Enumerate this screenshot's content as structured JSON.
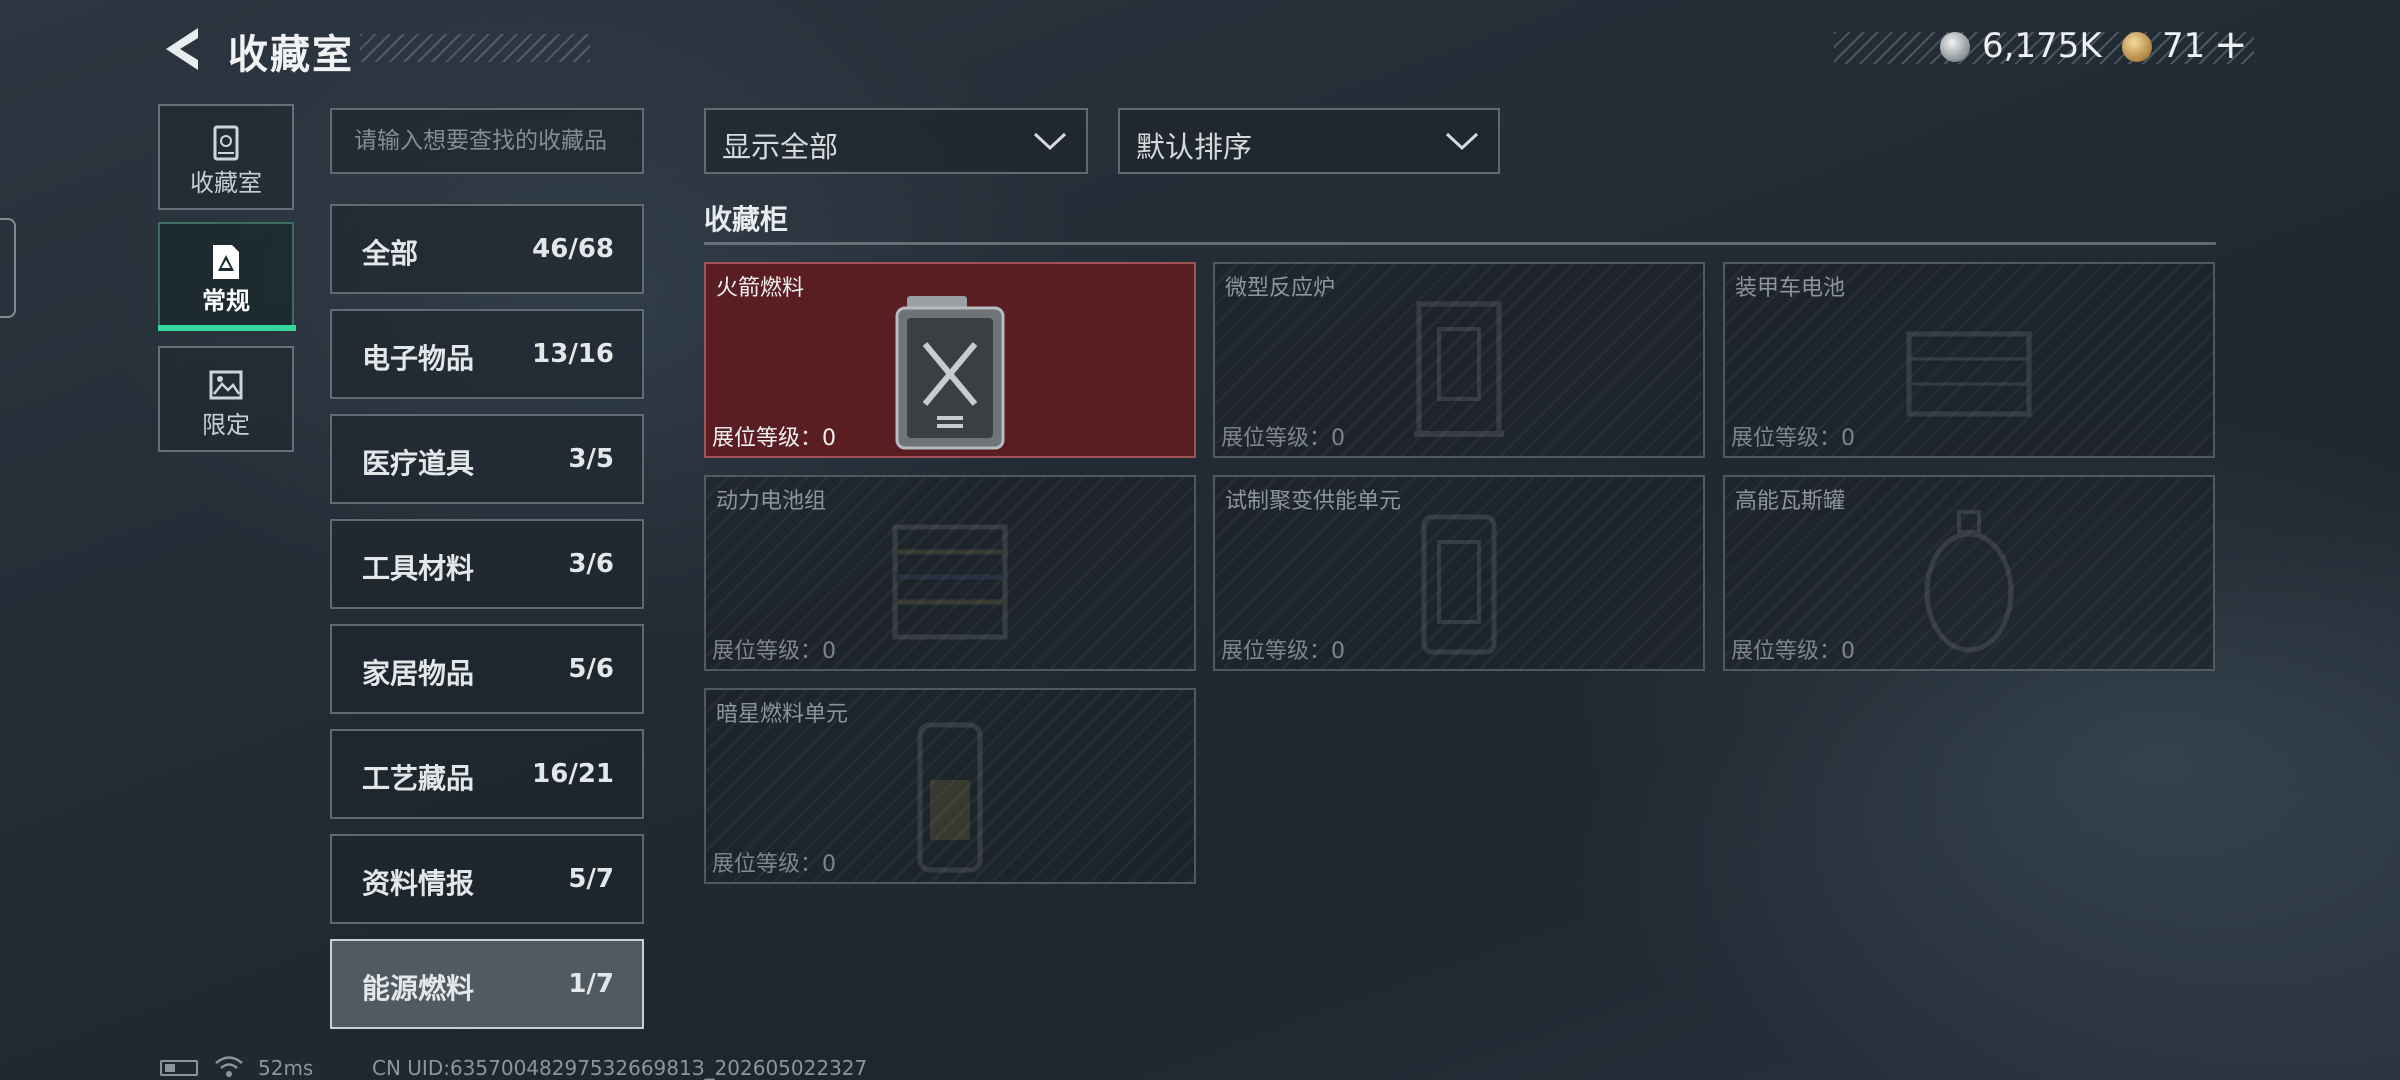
{
  "header": {
    "title": "收藏室",
    "currency": {
      "silver": "6,175K",
      "gold": "71",
      "add_symbol": "+"
    }
  },
  "left_nav": [
    {
      "label": "收藏室",
      "icon": "trophy-cabinet-icon"
    },
    {
      "label": "常规",
      "icon": "document-icon",
      "selected": true
    },
    {
      "label": "限定",
      "icon": "picture-icon"
    }
  ],
  "search": {
    "placeholder": "请输入想要查找的收藏品"
  },
  "categories": [
    {
      "name": "全部",
      "count": "46/68"
    },
    {
      "name": "电子物品",
      "count": "13/16"
    },
    {
      "name": "医疗道具",
      "count": "3/5"
    },
    {
      "name": "工具材料",
      "count": "3/6"
    },
    {
      "name": "家居物品",
      "count": "5/6"
    },
    {
      "name": "工艺藏品",
      "count": "16/21"
    },
    {
      "name": "资料情报",
      "count": "5/7"
    },
    {
      "name": "能源燃料",
      "count": "1/7",
      "selected": true
    }
  ],
  "filters": {
    "show": "显示全部",
    "sort": "默认排序"
  },
  "section_title": "收藏柜",
  "items": [
    {
      "name": "火箭燃料",
      "level": "展位等级：0",
      "unlocked": true
    },
    {
      "name": "微型反应炉",
      "level": "展位等级：0",
      "unlocked": false
    },
    {
      "name": "装甲车电池",
      "level": "展位等级：0",
      "unlocked": false
    },
    {
      "name": "动力电池组",
      "level": "展位等级：0",
      "unlocked": false
    },
    {
      "name": "试制聚变供能单元",
      "level": "展位等级：0",
      "unlocked": false
    },
    {
      "name": "高能瓦斯罐",
      "level": "展位等级：0",
      "unlocked": false
    },
    {
      "name": "暗星燃料单元",
      "level": "展位等级：0",
      "unlocked": false
    }
  ],
  "footer": {
    "ping": "52ms",
    "uid": "CN UID:6357004829753266981З_202605022327"
  },
  "colors": {
    "accent_green": "#33d89a",
    "unlocked_red": "#5a1e22"
  }
}
